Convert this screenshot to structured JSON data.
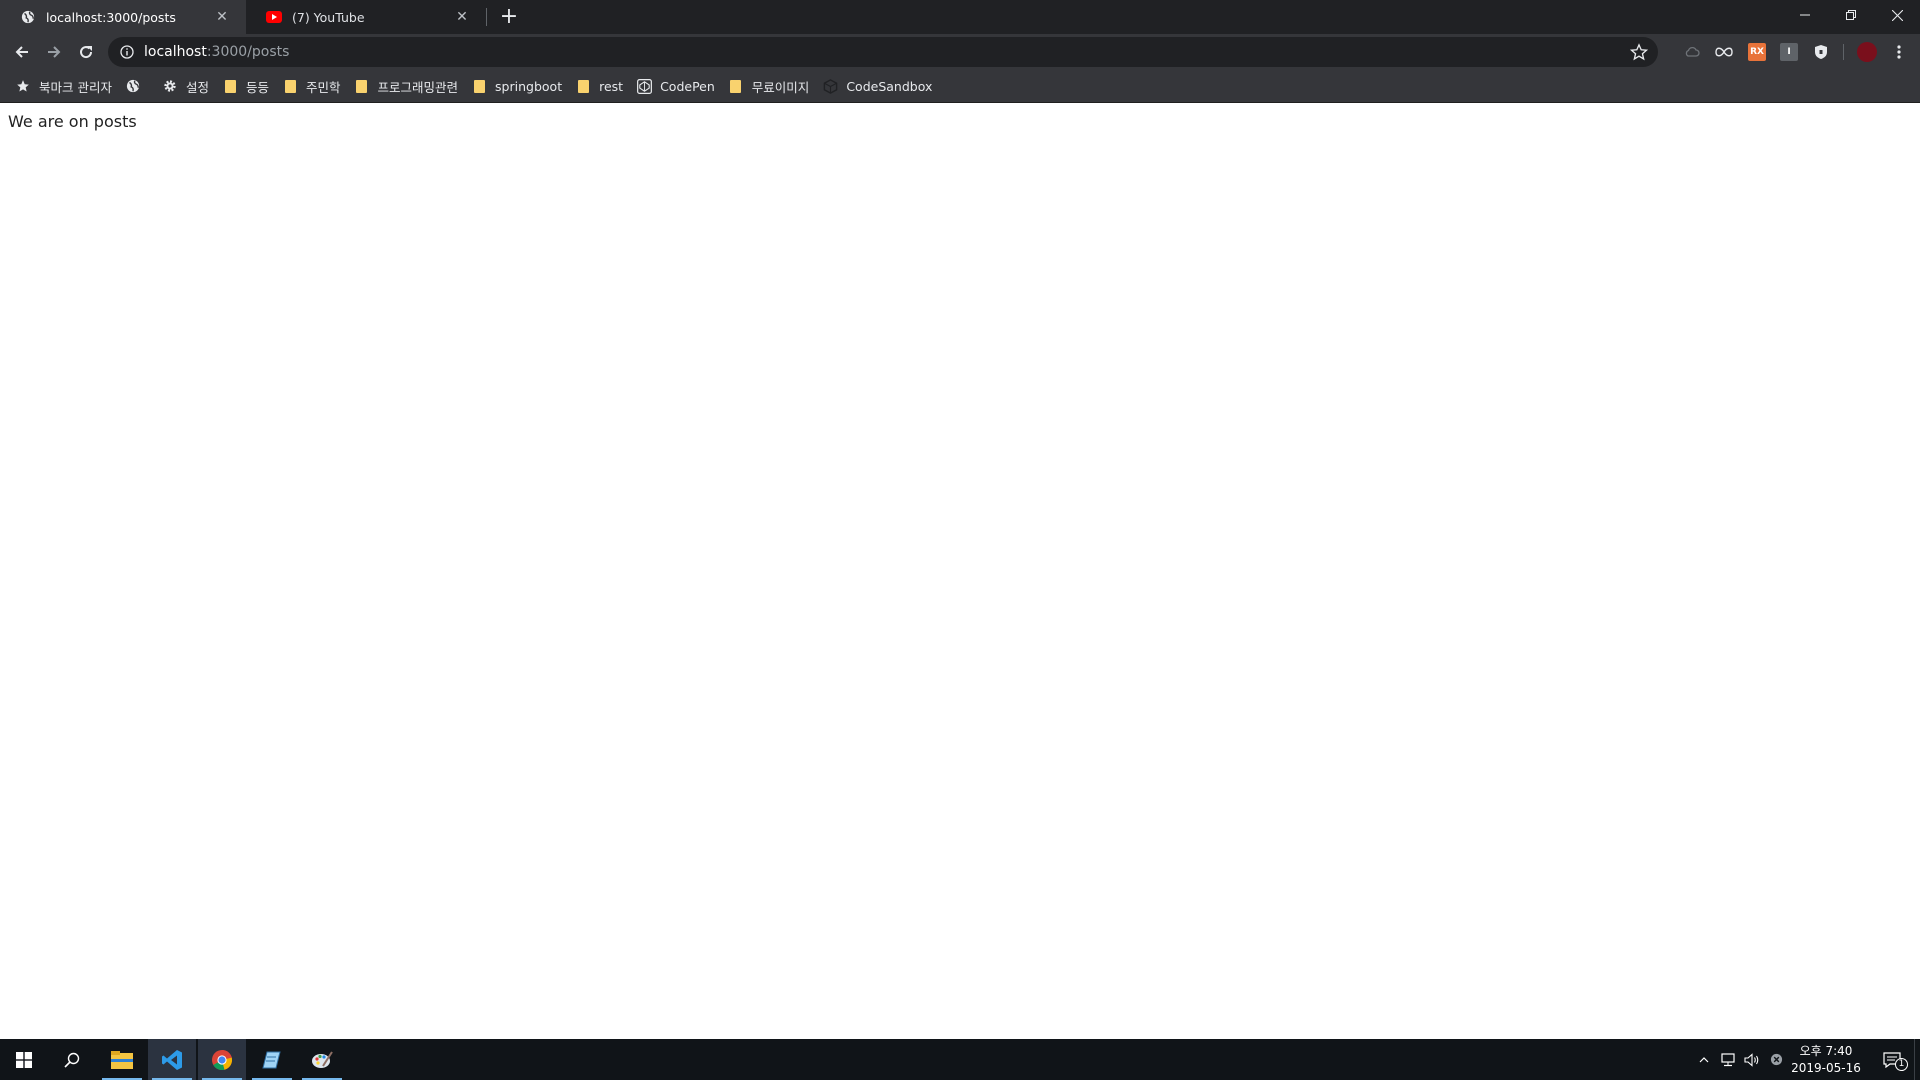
{
  "browser": {
    "tabs": [
      {
        "title": "localhost:3000/posts",
        "active": true,
        "favicon": "globe-icon"
      },
      {
        "title": "(7) YouTube",
        "active": false,
        "favicon": "youtube-icon"
      }
    ],
    "address": {
      "host": "localhost",
      "path": ":3000/posts"
    },
    "bookmarks": [
      {
        "label": "북마크 관리자",
        "icon": "star-icon"
      },
      {
        "label": "",
        "icon": "globe-icon"
      },
      {
        "label": "설정",
        "icon": "gear-icon"
      },
      {
        "label": "등등",
        "icon": "folder-icon"
      },
      {
        "label": "주민학",
        "icon": "folder-icon"
      },
      {
        "label": "프로그래밍관련",
        "icon": "folder-icon"
      },
      {
        "label": "springboot",
        "icon": "folder-icon"
      },
      {
        "label": "rest",
        "icon": "folder-icon"
      },
      {
        "label": "CodePen",
        "icon": "codepen-icon"
      },
      {
        "label": "무료이미지",
        "icon": "folder-icon"
      },
      {
        "label": "CodeSandbox",
        "icon": "codesandbox-icon"
      }
    ],
    "extensions": [
      {
        "icon": "cloud-icon"
      },
      {
        "icon": "infinity-icon"
      },
      {
        "label": "RX",
        "icon": "rx-extension-icon",
        "color": "#e8733a"
      },
      {
        "label": "I",
        "icon": "info-extension-icon",
        "color": "#5f6368"
      },
      {
        "icon": "shield-extension-icon"
      }
    ]
  },
  "page": {
    "text": "We are on posts"
  },
  "taskbar": {
    "apps": [
      "start-icon",
      "search-icon",
      "file-explorer-icon",
      "vscode-icon",
      "chrome-icon",
      "notepad-icon",
      "paint-icon"
    ],
    "clock": {
      "time": "오후 7:40",
      "date": "2019-05-16"
    },
    "notification_count": "1"
  },
  "colors": {
    "tabstrip_bg": "#202124",
    "toolbar_bg": "#35363a",
    "taskbar_bg": "#101418",
    "folder": "#f9d26e"
  }
}
